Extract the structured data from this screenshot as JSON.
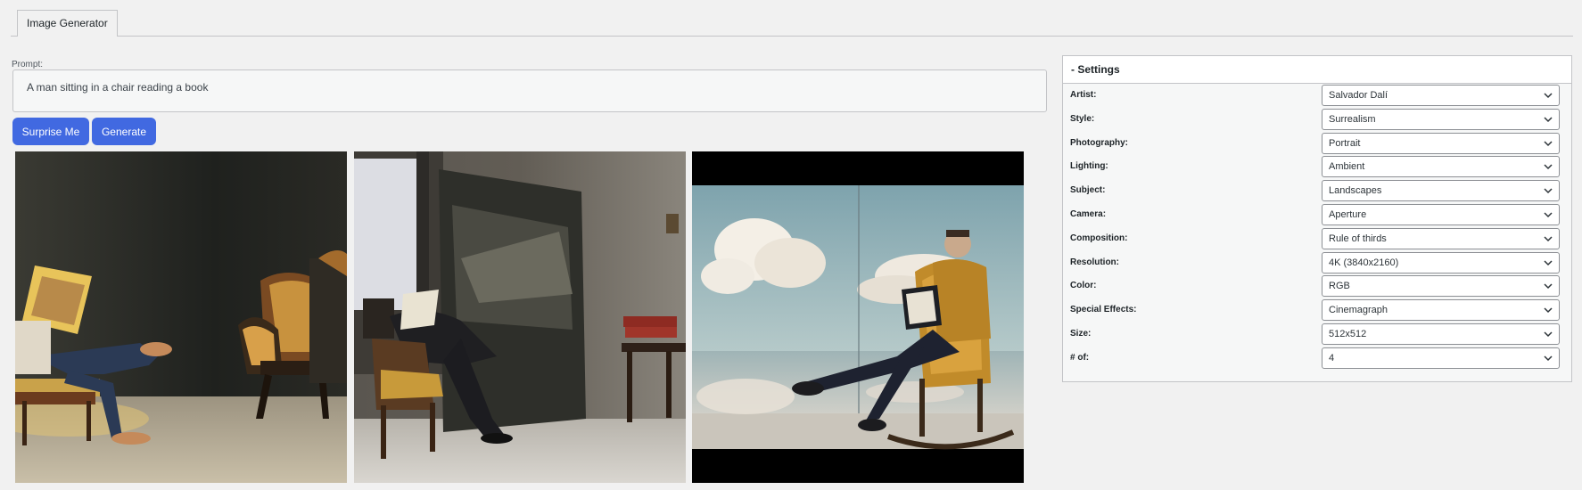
{
  "tabs": [
    {
      "label": "Image Generator",
      "active": true
    }
  ],
  "prompt": {
    "label": "Prompt:",
    "value": "A man sitting in a chair reading a book"
  },
  "buttons": {
    "surprise": "Surprise Me",
    "generate": "Generate"
  },
  "images": [
    {
      "name": "generated-image-1"
    },
    {
      "name": "generated-image-2"
    },
    {
      "name": "generated-image-3"
    }
  ],
  "settings": {
    "title": "- Settings",
    "fields": [
      {
        "label": "Artist:",
        "value": "Salvador Dalí"
      },
      {
        "label": "Style:",
        "value": "Surrealism"
      },
      {
        "label": "Photography:",
        "value": "Portrait"
      },
      {
        "label": "Lighting:",
        "value": "Ambient"
      },
      {
        "label": "Subject:",
        "value": "Landscapes"
      },
      {
        "label": "Camera:",
        "value": "Aperture"
      },
      {
        "label": "Composition:",
        "value": "Rule of thirds"
      },
      {
        "label": "Resolution:",
        "value": "4K (3840x2160)"
      },
      {
        "label": "Color:",
        "value": "RGB"
      },
      {
        "label": "Special Effects:",
        "value": "Cinemagraph"
      },
      {
        "label": "Size:",
        "value": "512x512"
      },
      {
        "label": "# of:",
        "value": "4"
      }
    ]
  },
  "colors": {
    "accent": "#4169e1",
    "background": "#f1f1f1",
    "border": "#c3c4c7"
  },
  "icons": {
    "select": "chevron-down-icon"
  }
}
